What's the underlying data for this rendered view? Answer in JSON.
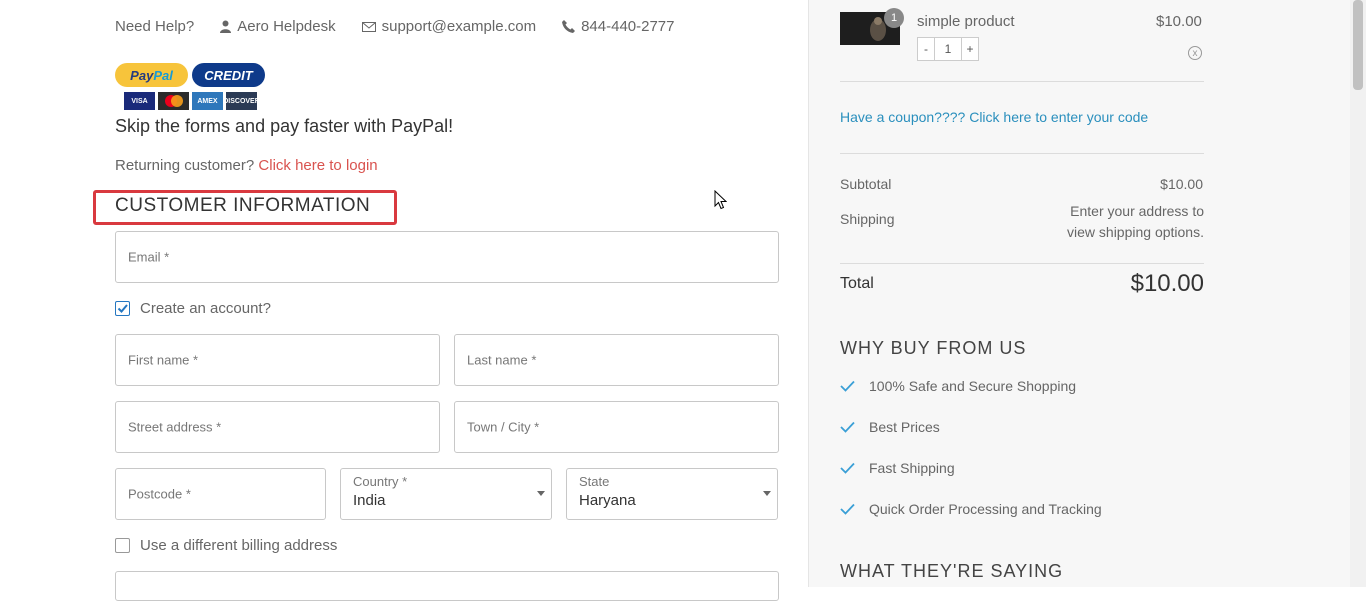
{
  "help": {
    "label": "Need Help?",
    "helpdesk": "Aero Helpdesk",
    "email": "support@example.com",
    "phone": "844-440-2777"
  },
  "paypal": {
    "paypal_label_a": "Pay",
    "paypal_label_b": "Pal",
    "credit_label": "CREDIT",
    "cards": [
      "VISA",
      "MC",
      "AMEX",
      "DISCOVER"
    ],
    "tagline": "Skip the forms and pay faster with PayPal!"
  },
  "returning": {
    "text": "Returning customer?",
    "link": "Click here to login"
  },
  "customer_info": {
    "title": "CUSTOMER INFORMATION",
    "email_placeholder": "Email *",
    "create_account_label": "Create an account?",
    "create_account_checked": true,
    "first_name_placeholder": "First name *",
    "last_name_placeholder": "Last name *",
    "street_placeholder": "Street address *",
    "town_placeholder": "Town / City *",
    "postcode_placeholder": "Postcode *",
    "country_label": "Country *",
    "country_value": "India",
    "state_label": "State",
    "state_value": "Haryana",
    "different_billing_label": "Use a different billing address",
    "different_billing_checked": false
  },
  "cart": {
    "badge": "1",
    "product_name": "simple product",
    "product_price": "$10.00",
    "qty_minus": "-",
    "qty_value": "1",
    "qty_plus": "+",
    "remove": "x",
    "coupon_text": "Have a coupon???? Click here to enter your code",
    "subtotal_label": "Subtotal",
    "subtotal_value": "$10.00",
    "shipping_label": "Shipping",
    "shipping_value": "Enter your address to view shipping options.",
    "total_label": "Total",
    "total_value": "$10.00"
  },
  "why": {
    "title": "WHY BUY FROM US",
    "items": [
      "100% Safe and Secure Shopping",
      "Best Prices",
      "Fast Shipping",
      "Quick Order Processing and Tracking"
    ]
  },
  "saying": {
    "title": "WHAT THEY'RE SAYING"
  },
  "colors": {
    "highlight_box": "#d9393f",
    "login_link": "#d9534f",
    "coupon_link": "#2a8fbd",
    "check_accent": "#2577c1"
  }
}
